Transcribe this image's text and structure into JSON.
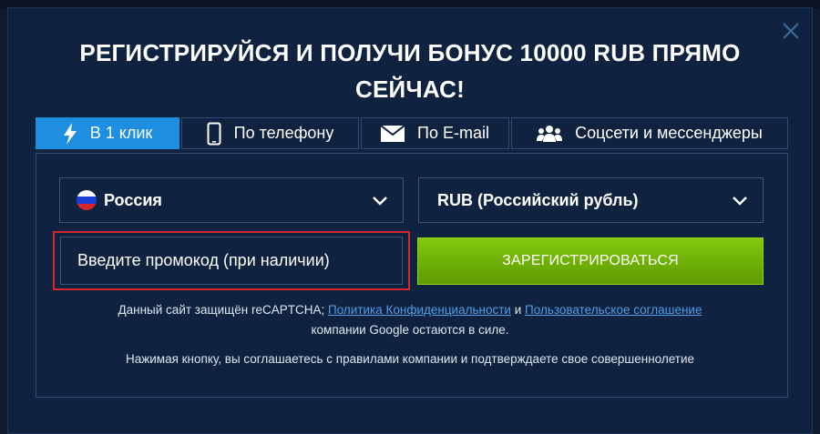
{
  "title": "РЕГИСТРИРУЙСЯ И ПОЛУЧИ БОНУС 10000 RUB ПРЯМО СЕЙЧАС!",
  "tabs": [
    {
      "label": "В 1 клик",
      "icon": "lightning-icon",
      "active": true
    },
    {
      "label": "По телефону",
      "icon": "phone-icon",
      "active": false
    },
    {
      "label": "По E-mail",
      "icon": "envelope-icon",
      "active": false
    },
    {
      "label": "Соцсети и мессенджеры",
      "icon": "users-icon",
      "active": false
    }
  ],
  "country_select": {
    "value": "Россия",
    "icon": "russia-flag-icon"
  },
  "currency_select": {
    "value": "RUB (Российский рубль)"
  },
  "promo": {
    "placeholder": "Введите промокод (при наличии)"
  },
  "register_label": "ЗАРЕГИСТРИРОВАТЬСЯ",
  "legal": {
    "prefix": "Данный сайт защищён reCAPTCHA;",
    "privacy_link": "Политика Конфиденциальности",
    "and": "и",
    "terms_link": "Пользовательское соглашение",
    "suffix": "компании Google остаются в силе."
  },
  "agree_text": "Нажимая кнопку, вы соглашаетесь с правилами компании и подтверждаете свое совершеннолетие",
  "colors": {
    "background": "#0f2340",
    "accent": "#1e8fe0",
    "register": "#6fb304",
    "highlight": "#d6262b",
    "link": "#4d9ee8"
  }
}
